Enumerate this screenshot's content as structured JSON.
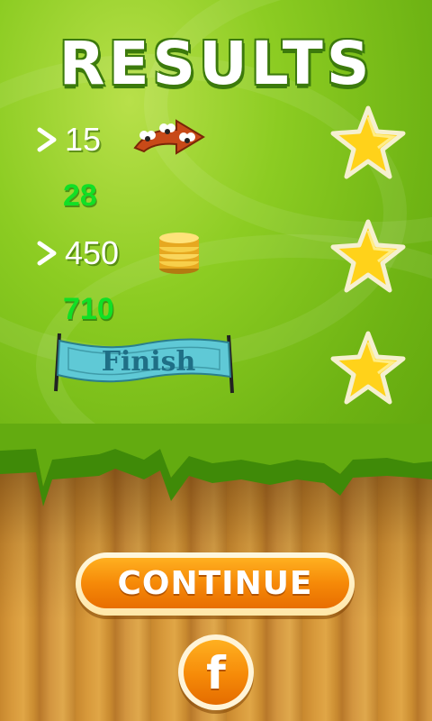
{
  "title": "RESULTS",
  "rows": [
    {
      "value": "15",
      "icon": "fly-arrow-icon",
      "bonus": "28",
      "star": "star-icon"
    },
    {
      "value": "450",
      "icon": "coin-stack-icon",
      "bonus": "710",
      "star": "star-icon"
    },
    {
      "banner": "Finish",
      "icon": "finish-banner-icon",
      "star": "star-icon"
    }
  ],
  "buttons": {
    "continue_label": "CONTINUE",
    "facebook_label": "f"
  },
  "colors": {
    "grass": "#7cc018",
    "wood": "#d39640",
    "bonus_text": "#11e025",
    "button": "#f68a08",
    "star": "#ffd21a",
    "banner": "#5fc9d6"
  }
}
